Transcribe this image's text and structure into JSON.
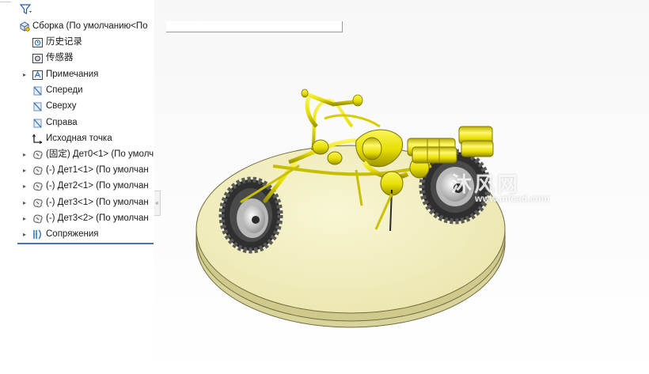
{
  "tree": {
    "root": "Сборка  (По умолчанию<По",
    "items": [
      {
        "label": "历史记录",
        "icon": "history-icon",
        "expandable": false
      },
      {
        "label": "传感器",
        "icon": "sensor-icon",
        "expandable": false
      },
      {
        "label": "Примечания",
        "icon": "annotations-icon",
        "expandable": true
      },
      {
        "label": "Спереди",
        "icon": "plane-icon",
        "expandable": false
      },
      {
        "label": "Сверху",
        "icon": "plane-icon",
        "expandable": false
      },
      {
        "label": "Справа",
        "icon": "plane-icon",
        "expandable": false
      },
      {
        "label": "Исходная точка",
        "icon": "origin-icon",
        "expandable": false
      },
      {
        "label": "(固定) Дет0<1> (По умолч",
        "icon": "part-icon",
        "expandable": true
      },
      {
        "label": "(-) Дет1<1> (По умолчан",
        "icon": "part-icon",
        "expandable": true
      },
      {
        "label": "(-) Дет2<1> (По умолчан",
        "icon": "part-icon",
        "expandable": true
      },
      {
        "label": "(-) Дет3<1> (По умолчан",
        "icon": "part-icon",
        "expandable": true
      },
      {
        "label": "(-) Дет3<2> (По умолчан",
        "icon": "part-icon",
        "expandable": true
      },
      {
        "label": "Сопряжения",
        "icon": "mates-icon",
        "expandable": true
      }
    ]
  },
  "collapse_glyph": "«",
  "watermark": {
    "main": "沐风网",
    "url": "www.mfcad.com"
  },
  "colors": {
    "base_top": "#f3f0c4",
    "base_side": "#d9d49a",
    "model": "#e8e000",
    "tire": "#3a3a3a",
    "selection_underline": "#4a74c0"
  }
}
